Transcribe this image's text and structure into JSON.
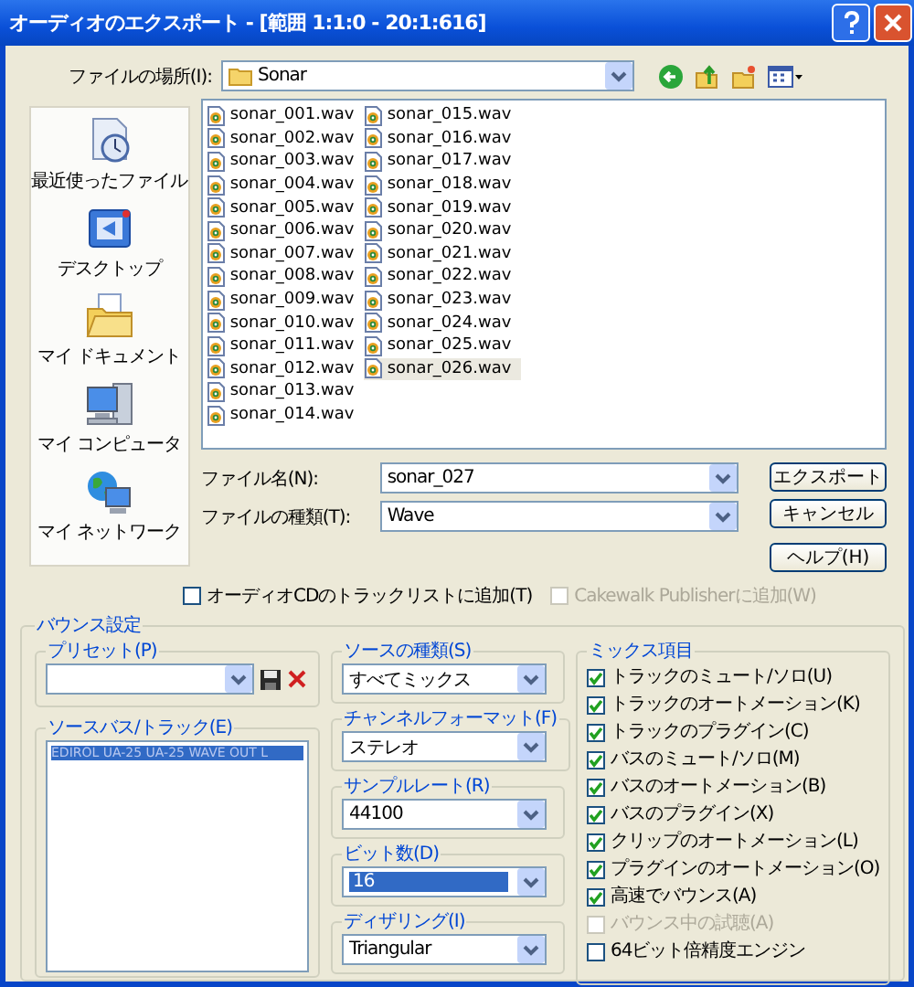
{
  "window": {
    "title": "オーディオのエクスポート - [範囲 1:1:0 - 20:1:616]"
  },
  "location": {
    "label": "ファイルの場所(I):",
    "value": "Sonar"
  },
  "places": [
    {
      "kind": "recent",
      "label": "最近使ったファイル"
    },
    {
      "kind": "desktop",
      "label": "デスクトップ"
    },
    {
      "kind": "documents",
      "label": "マイ ドキュメント"
    },
    {
      "kind": "computer",
      "label": "マイ コンピュータ"
    },
    {
      "kind": "network",
      "label": "マイ ネットワーク"
    }
  ],
  "files": [
    {
      "name": "sonar_001.wav",
      "selected": false
    },
    {
      "name": "sonar_002.wav",
      "selected": false
    },
    {
      "name": "sonar_003.wav",
      "selected": false
    },
    {
      "name": "sonar_004.wav",
      "selected": false
    },
    {
      "name": "sonar_005.wav",
      "selected": false
    },
    {
      "name": "sonar_006.wav",
      "selected": false
    },
    {
      "name": "sonar_007.wav",
      "selected": false
    },
    {
      "name": "sonar_008.wav",
      "selected": false
    },
    {
      "name": "sonar_009.wav",
      "selected": false
    },
    {
      "name": "sonar_010.wav",
      "selected": false
    },
    {
      "name": "sonar_011.wav",
      "selected": false
    },
    {
      "name": "sonar_012.wav",
      "selected": false
    },
    {
      "name": "sonar_013.wav",
      "selected": false
    },
    {
      "name": "sonar_014.wav",
      "selected": false
    },
    {
      "name": "sonar_015.wav",
      "selected": false
    },
    {
      "name": "sonar_016.wav",
      "selected": false
    },
    {
      "name": "sonar_017.wav",
      "selected": false
    },
    {
      "name": "sonar_018.wav",
      "selected": false
    },
    {
      "name": "sonar_019.wav",
      "selected": false
    },
    {
      "name": "sonar_020.wav",
      "selected": false
    },
    {
      "name": "sonar_021.wav",
      "selected": false
    },
    {
      "name": "sonar_022.wav",
      "selected": false
    },
    {
      "name": "sonar_023.wav",
      "selected": false
    },
    {
      "name": "sonar_024.wav",
      "selected": false
    },
    {
      "name": "sonar_025.wav",
      "selected": false
    },
    {
      "name": "sonar_026.wav",
      "selected": true
    }
  ],
  "file_name": {
    "label": "ファイル名(N):",
    "value": "sonar_027"
  },
  "file_type": {
    "label": "ファイルの種類(T):",
    "value": "Wave"
  },
  "buttons": [
    "エクスポート",
    "キャンセル",
    "ヘルプ(H)"
  ],
  "options": [
    {
      "label": "オーディオCDのトラックリストに追加(T)",
      "checked": false,
      "disabled": false
    },
    {
      "label": "Cakewalk Publisherに追加(W)",
      "checked": false,
      "disabled": true
    }
  ],
  "bounce": {
    "title": "バウンス設定",
    "preset": {
      "label": "プリセット(P)"
    },
    "source_tracks": {
      "label": "ソースバス/トラック(E)",
      "items": [
        {
          "label": "EDIROL UA-25 UA-25 WAVE OUT L",
          "selected": true
        }
      ]
    },
    "settings": [
      {
        "label": "ソースの種類(S)",
        "value": "すべてミックス",
        "highlighted": false
      },
      {
        "label": "チャンネルフォーマット(F)",
        "value": "ステレオ",
        "highlighted": false
      },
      {
        "label": "サンプルレート(R)",
        "value": "44100",
        "highlighted": false
      },
      {
        "label": "ビット数(D)",
        "value": "16",
        "highlighted": true
      },
      {
        "label": "ディザリング(I)",
        "value": "Triangular",
        "highlighted": false
      }
    ],
    "mix": {
      "title": "ミックス項目",
      "items": [
        {
          "label": "トラックのミュート/ソロ(U)",
          "checked": true,
          "disabled": false
        },
        {
          "label": "トラックのオートメーション(K)",
          "checked": true,
          "disabled": false
        },
        {
          "label": "トラックのプラグイン(C)",
          "checked": true,
          "disabled": false
        },
        {
          "label": "バスのミュート/ソロ(M)",
          "checked": true,
          "disabled": false
        },
        {
          "label": "バスのオートメーション(B)",
          "checked": true,
          "disabled": false
        },
        {
          "label": "バスのプラグイン(X)",
          "checked": true,
          "disabled": false
        },
        {
          "label": "クリップのオートメーション(L)",
          "checked": true,
          "disabled": false
        },
        {
          "label": "プラグインのオートメーション(O)",
          "checked": true,
          "disabled": false
        },
        {
          "label": "高速でバウンス(A)",
          "checked": true,
          "disabled": false
        },
        {
          "label": "バウンス中の試聴(A)",
          "checked": false,
          "disabled": true
        },
        {
          "label": "64ビット倍精度エンジン",
          "checked": false,
          "disabled": false
        }
      ]
    }
  }
}
